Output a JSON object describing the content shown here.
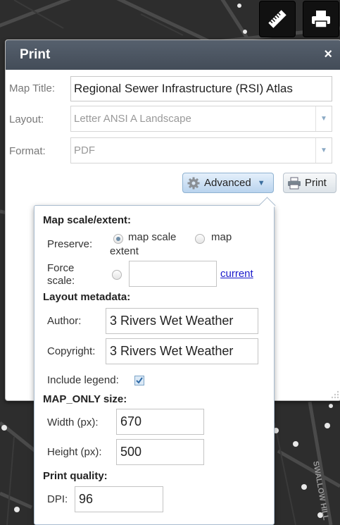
{
  "map": {
    "street_label": "SWALLOW HILL"
  },
  "toolbar": {
    "measure_icon": "ruler-icon",
    "print_icon": "printer-icon"
  },
  "print_panel": {
    "title": "Print",
    "close_symbol": "×",
    "map_title_label": "Map Title:",
    "map_title_value": "Regional Sewer Infrastructure (RSI) Atlas",
    "layout_label": "Layout:",
    "layout_value": "Letter ANSI A Landscape",
    "format_label": "Format:",
    "format_value": "PDF",
    "advanced_button": "Advanced",
    "print_button": "Print"
  },
  "advanced": {
    "map_scale_heading": "Map scale/extent:",
    "preserve_label": "Preserve:",
    "preserve_options": [
      {
        "label": "map scale",
        "checked": true
      },
      {
        "label": "map",
        "checked": false
      }
    ],
    "preserve_option_wrap": "extent",
    "force_scale_label_1": "Force",
    "force_scale_label_2": "scale:",
    "force_scale_value": "",
    "current_link": "current",
    "layout_metadata_heading": "Layout metadata:",
    "author_label": "Author:",
    "author_value": "3 Rivers Wet Weather",
    "copyright_label": "Copyright:",
    "copyright_value": "3 Rivers Wet Weather",
    "include_legend_label": "Include legend:",
    "include_legend_checked": true,
    "map_only_heading": "MAP_ONLY size:",
    "width_label": "Width (px):",
    "width_value": "670",
    "height_label": "Height (px):",
    "height_value": "500",
    "print_quality_heading": "Print quality:",
    "dpi_label": "DPI:",
    "dpi_value": "96"
  },
  "colors": {
    "header_bg": "#4b5563",
    "accent_blue": "#8fb2d1",
    "link": "#1a1acb"
  }
}
